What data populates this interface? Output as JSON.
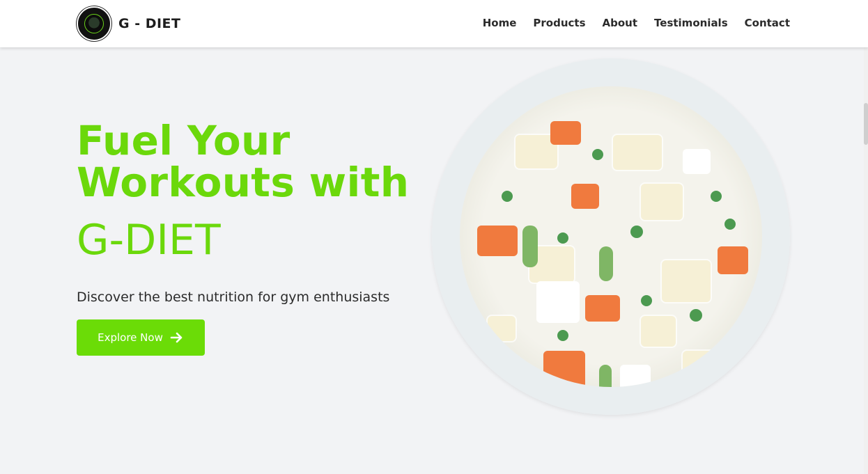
{
  "brand": {
    "name": "G - DIET",
    "logo_icon": "g-diet-logo-icon"
  },
  "nav": {
    "items": [
      "Home",
      "Products",
      "About",
      "Testimonials",
      "Contact"
    ]
  },
  "hero": {
    "heading_line1": "Fuel Your",
    "heading_line2": "Workouts with",
    "heading_brand": "G-DIET",
    "subtitle": "Discover the best nutrition for gym enthusiasts",
    "cta_label": "Explore Now",
    "cta_icon": "arrow-right-icon"
  },
  "colors": {
    "accent": "#6bd80b",
    "button": "#6bdc07",
    "text": "#2b2b2b",
    "background": "#f2f3f5"
  }
}
